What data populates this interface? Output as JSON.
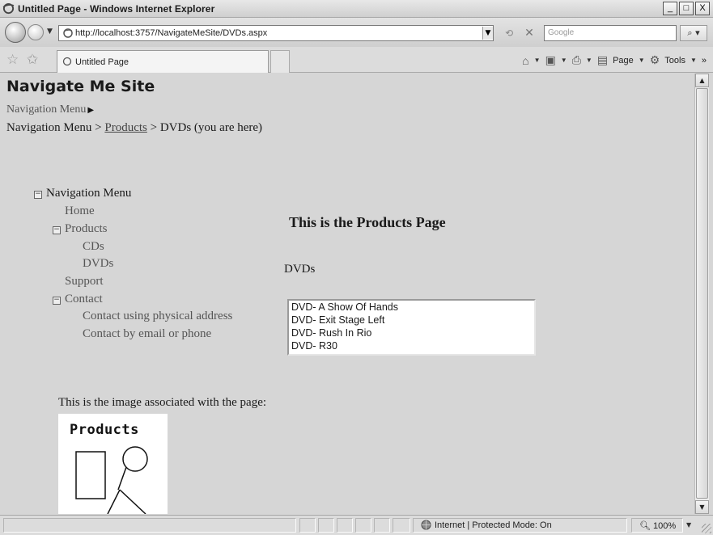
{
  "window": {
    "title": "Untitled Page - Windows Internet Explorer",
    "minimize_label": "_",
    "maximize_label": "□",
    "close_label": "X"
  },
  "address": {
    "url": "http://localhost:3757/NavigateMeSite/DVDs.aspx",
    "search_placeholder": "Google"
  },
  "tabs": {
    "active_label": "Untitled Page"
  },
  "commands": {
    "page_label": "Page",
    "tools_label": "Tools",
    "more_label": "»"
  },
  "page": {
    "site_title": "Navigate Me Site",
    "menu_root": "Navigation Menu",
    "breadcrumb": {
      "root": "Navigation Menu",
      "separator1": " > ",
      "parent": "Products",
      "separator2": " > ",
      "current": "DVDs (you are here)"
    },
    "tree": {
      "root": "Navigation Menu",
      "home": "Home",
      "products": "Products",
      "cds": "CDs",
      "dvds": "DVDs",
      "support": "Support",
      "contact": "Contact",
      "contact_physical": "Contact using physical address",
      "contact_email": "Contact by email or phone"
    },
    "heading": "This is the Products Page",
    "dvds_label": "DVDs",
    "dvd_list": [
      "DVD- A Show Of Hands",
      "DVD- Exit Stage Left",
      "DVD- Rush In Rio",
      "DVD- R30"
    ],
    "image_caption": "This is the image associated with the page:",
    "image_title": "Products"
  },
  "status": {
    "zone": "Internet | Protected Mode: On",
    "zoom": "100%"
  },
  "colors": {
    "page_background": "#d6d6d6",
    "link_gray": "#555555"
  }
}
